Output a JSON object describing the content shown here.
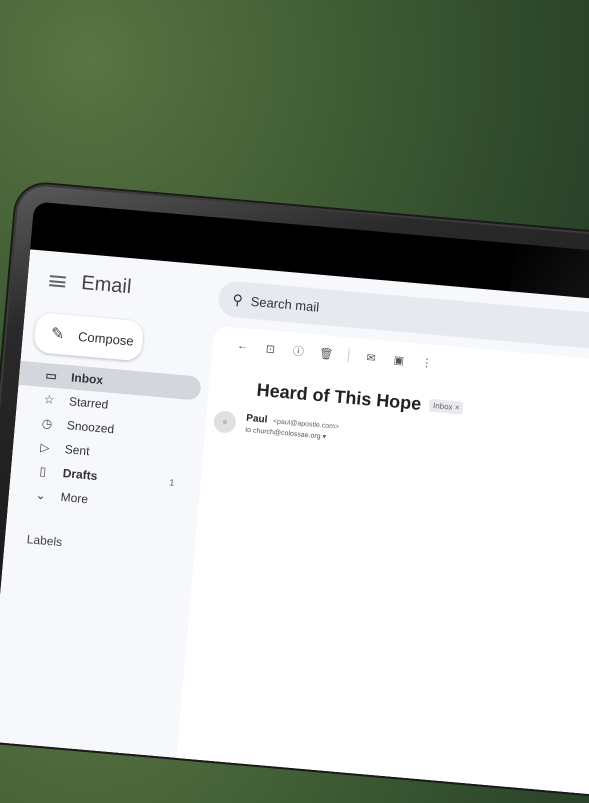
{
  "app": {
    "brand_name": "Email"
  },
  "compose": {
    "label": "Compose"
  },
  "nav": [
    {
      "label": "Inbox",
      "icon": "inbox-icon",
      "glyph": "▭",
      "active": true
    },
    {
      "label": "Starred",
      "icon": "star-icon",
      "glyph": "☆"
    },
    {
      "label": "Snoozed",
      "icon": "clock-icon",
      "glyph": "◷"
    },
    {
      "label": "Sent",
      "icon": "send-icon",
      "glyph": "▷"
    },
    {
      "label": "Drafts",
      "icon": "draft-icon",
      "glyph": "▯",
      "count": "1",
      "bold": true
    },
    {
      "label": "More",
      "icon": "chevron-down-icon",
      "glyph": "⌄"
    }
  ],
  "labels": {
    "heading": "Labels"
  },
  "search": {
    "placeholder": "Search mail"
  },
  "message": {
    "subject": "Heard of This Hope",
    "label_chip": "Inbox ×",
    "sender_name": "Paul",
    "sender_email": "<paul@apostle.com>",
    "recipient": "to church@colossae.org ▾"
  }
}
